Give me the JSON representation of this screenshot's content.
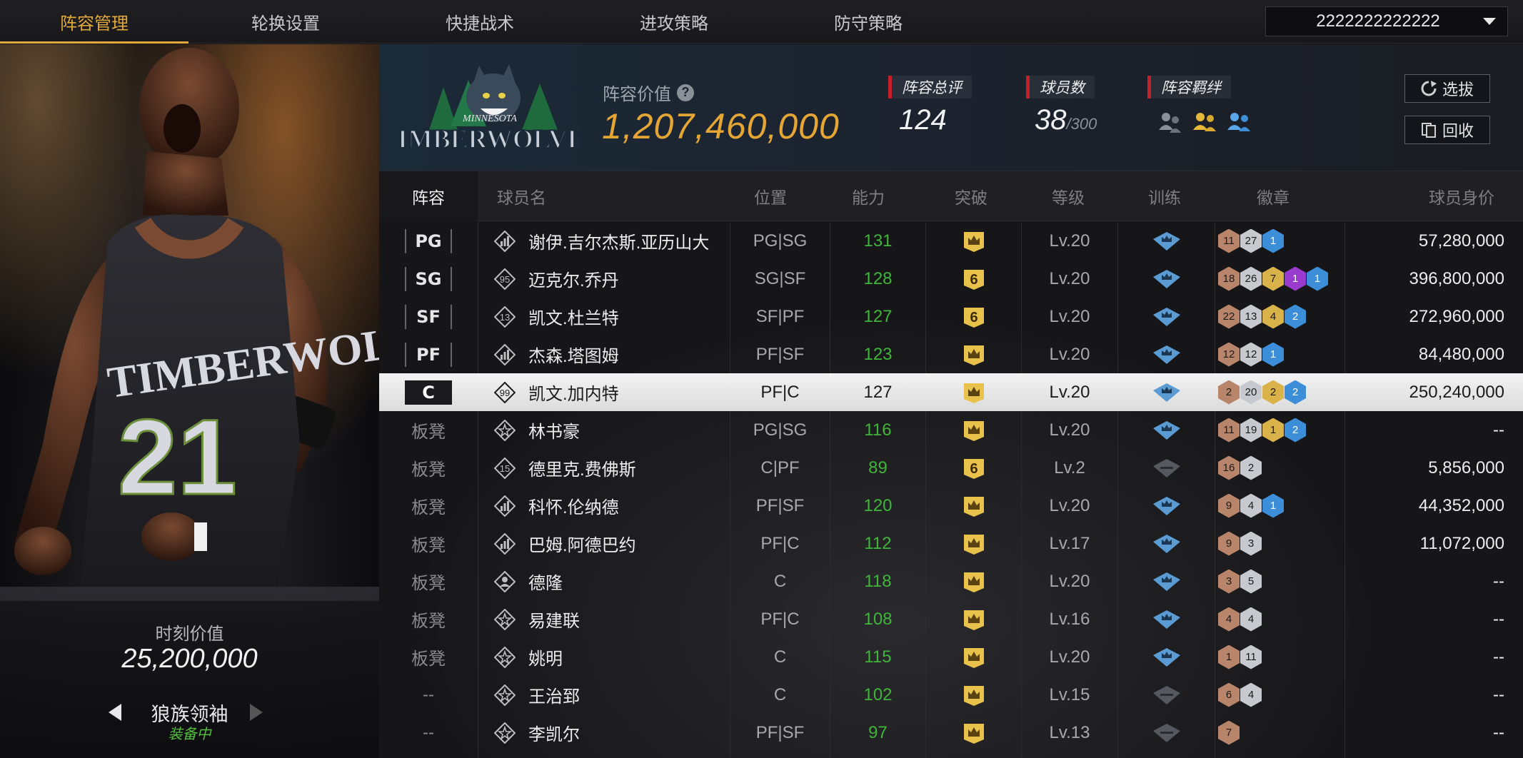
{
  "nav": {
    "tabs": [
      "阵容管理",
      "轮换设置",
      "快捷战术",
      "进攻策略",
      "防守策略"
    ],
    "active_tab": 0,
    "dropdown_value": "2222222222222"
  },
  "hero": {
    "moment_value_label": "时刻价值",
    "moment_value": "25,200,000",
    "card_title": "狼族领袖",
    "status": "装备中"
  },
  "header": {
    "team_logo_top": "MINNESOTA",
    "team_logo_main": "TIMBERWOLVES",
    "lineup_value_label": "阵容价值",
    "help_icon": "?",
    "lineup_value": "1,207,460,000",
    "rating_label": "阵容总评",
    "rating_value": "124",
    "players_label": "球员数",
    "players_value": "38",
    "players_max": "/300",
    "bond_label": "阵容羁绊",
    "bond_icon_names": [
      "bond-group-gray-icon",
      "bond-group-gold-icon",
      "bond-group-blue-icon"
    ],
    "select_button": "选拔",
    "recycle_button": "回收"
  },
  "table": {
    "headers": [
      "阵容",
      "球员名",
      "位置",
      "能力",
      "突破",
      "等级",
      "训练",
      "徽章",
      "球员身价"
    ],
    "rows": [
      {
        "slot": "PG",
        "starter": true,
        "icon": "bars",
        "name": "谢伊.吉尔杰斯.亚历山大",
        "pos": "PG|SG",
        "ovr": "131",
        "breakthrough": "crown",
        "level": "Lv.20",
        "trained": true,
        "badges": [
          [
            "bronze",
            "11"
          ],
          [
            "silver",
            "27"
          ],
          [
            "blue",
            "1"
          ]
        ],
        "value": "57,280,000"
      },
      {
        "slot": "SG",
        "starter": true,
        "icon": "95",
        "name": "迈克尔.乔丹",
        "pos": "SG|SF",
        "ovr": "128",
        "breakthrough": "6",
        "level": "Lv.20",
        "trained": true,
        "badges": [
          [
            "bronze",
            "18"
          ],
          [
            "silver",
            "26"
          ],
          [
            "gold",
            "7"
          ],
          [
            "purple",
            "1"
          ],
          [
            "blue",
            "1"
          ]
        ],
        "value": "396,800,000"
      },
      {
        "slot": "SF",
        "starter": true,
        "icon": "13",
        "name": "凯文.杜兰特",
        "pos": "SF|PF",
        "ovr": "127",
        "breakthrough": "6",
        "level": "Lv.20",
        "trained": true,
        "badges": [
          [
            "bronze",
            "22"
          ],
          [
            "silver",
            "13"
          ],
          [
            "gold",
            "4"
          ],
          [
            "blue",
            "2"
          ]
        ],
        "value": "272,960,000"
      },
      {
        "slot": "PF",
        "starter": true,
        "icon": "bars",
        "name": "杰森.塔图姆",
        "pos": "PF|SF",
        "ovr": "123",
        "breakthrough": "crown",
        "level": "Lv.20",
        "trained": true,
        "badges": [
          [
            "bronze",
            "12"
          ],
          [
            "silver",
            "12"
          ],
          [
            "blue",
            "1"
          ]
        ],
        "value": "84,480,000"
      },
      {
        "slot": "C",
        "starter": true,
        "selected": true,
        "icon": "99",
        "name": "凯文.加内特",
        "pos": "PF|C",
        "ovr": "127",
        "breakthrough": "crown",
        "level": "Lv.20",
        "trained": true,
        "badges": [
          [
            "bronze",
            "2"
          ],
          [
            "silver",
            "20"
          ],
          [
            "gold",
            "2"
          ],
          [
            "blue",
            "2"
          ]
        ],
        "value": "250,240,000"
      },
      {
        "slot": "板凳",
        "starter": false,
        "icon": "star",
        "name": "林书豪",
        "pos": "PG|SG",
        "ovr": "116",
        "breakthrough": "crown",
        "level": "Lv.20",
        "trained": true,
        "badges": [
          [
            "bronze",
            "11"
          ],
          [
            "silver",
            "19"
          ],
          [
            "gold",
            "1"
          ],
          [
            "blue",
            "2"
          ]
        ],
        "value": "--"
      },
      {
        "slot": "板凳",
        "starter": false,
        "icon": "15",
        "name": "德里克.费佛斯",
        "pos": "C|PF",
        "ovr": "89",
        "breakthrough": "6",
        "level": "Lv.2",
        "trained": false,
        "badges": [
          [
            "bronze",
            "16"
          ],
          [
            "silver",
            "2"
          ]
        ],
        "value": "5,856,000"
      },
      {
        "slot": "板凳",
        "starter": false,
        "icon": "bars",
        "name": "科怀.伦纳德",
        "pos": "PF|SF",
        "ovr": "120",
        "breakthrough": "crown",
        "level": "Lv.20",
        "trained": true,
        "badges": [
          [
            "bronze",
            "9"
          ],
          [
            "silver",
            "4"
          ],
          [
            "blue",
            "1"
          ]
        ],
        "value": "44,352,000"
      },
      {
        "slot": "板凳",
        "starter": false,
        "icon": "bars",
        "name": "巴姆.阿德巴约",
        "pos": "PF|C",
        "ovr": "112",
        "breakthrough": "crown",
        "level": "Lv.17",
        "trained": true,
        "badges": [
          [
            "bronze",
            "9"
          ],
          [
            "silver",
            "3"
          ]
        ],
        "value": "11,072,000"
      },
      {
        "slot": "板凳",
        "starter": false,
        "icon": "person",
        "name": "德隆",
        "pos": "C",
        "ovr": "118",
        "breakthrough": "crown",
        "level": "Lv.20",
        "trained": true,
        "badges": [
          [
            "bronze",
            "3"
          ],
          [
            "silver",
            "5"
          ]
        ],
        "value": "--"
      },
      {
        "slot": "板凳",
        "starter": false,
        "icon": "star",
        "name": "易建联",
        "pos": "PF|C",
        "ovr": "108",
        "breakthrough": "crown",
        "level": "Lv.16",
        "trained": true,
        "badges": [
          [
            "bronze",
            "4"
          ],
          [
            "silver",
            "4"
          ]
        ],
        "value": "--"
      },
      {
        "slot": "板凳",
        "starter": false,
        "icon": "star",
        "name": "姚明",
        "pos": "C",
        "ovr": "115",
        "breakthrough": "crown",
        "level": "Lv.20",
        "trained": true,
        "badges": [
          [
            "bronze",
            "1"
          ],
          [
            "silver",
            "11"
          ]
        ],
        "value": "--"
      },
      {
        "slot": "--",
        "starter": false,
        "icon": "star",
        "name": "王治郅",
        "pos": "C",
        "ovr": "102",
        "breakthrough": "crown",
        "level": "Lv.15",
        "trained": false,
        "badges": [
          [
            "bronze",
            "6"
          ],
          [
            "silver",
            "4"
          ]
        ],
        "value": "--"
      },
      {
        "slot": "--",
        "starter": false,
        "icon": "star",
        "name": "李凯尔",
        "pos": "PF|SF",
        "ovr": "97",
        "breakthrough": "crown",
        "level": "Lv.13",
        "trained": false,
        "badges": [
          [
            "bronze",
            "7"
          ]
        ],
        "value": "--"
      }
    ]
  }
}
